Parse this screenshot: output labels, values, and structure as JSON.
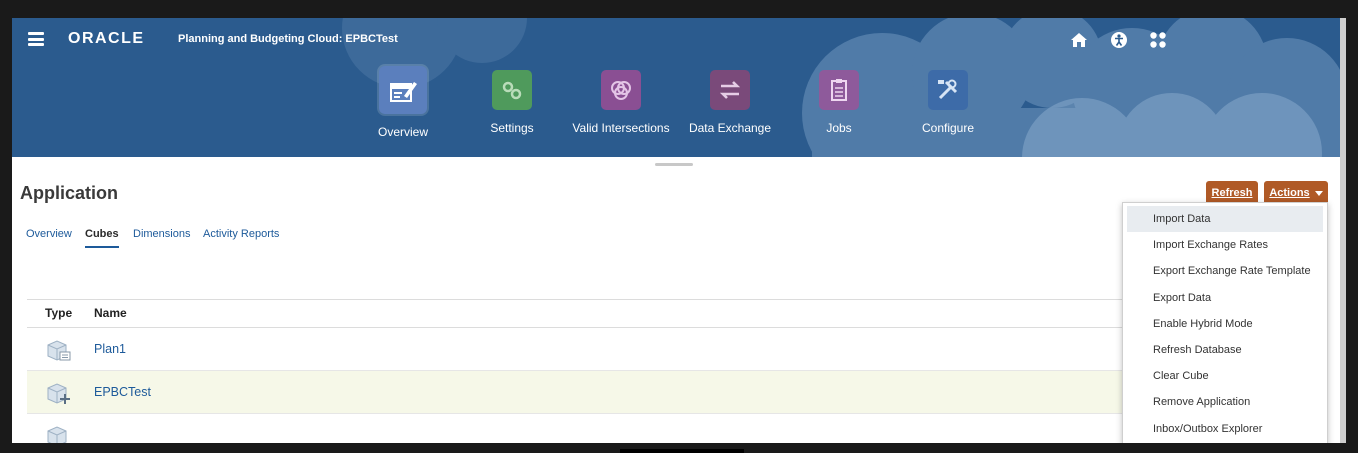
{
  "header": {
    "brand": "ORACLE",
    "app_title": "Planning and Budgeting Cloud: EPBCTest",
    "icons": [
      "menu-icon",
      "home-icon",
      "accessibility-icon",
      "apps-grid-icon"
    ]
  },
  "nav": {
    "items": [
      {
        "label": "Overview",
        "icon": "overview-icon",
        "color": "#5b7fbd"
      },
      {
        "label": "Settings",
        "icon": "settings-icon",
        "color": "#4f9a5c"
      },
      {
        "label": "Valid Intersections",
        "icon": "intersections-icon",
        "color": "#8a4f93"
      },
      {
        "label": "Data Exchange",
        "icon": "exchange-icon",
        "color": "#7a4a7a"
      },
      {
        "label": "Jobs",
        "icon": "jobs-icon",
        "color": "#8e5a9b"
      },
      {
        "label": "Configure",
        "icon": "configure-icon",
        "color": "#3d6ba8"
      }
    ],
    "active": "Overview"
  },
  "page": {
    "title": "Application",
    "refresh_label": "Refresh",
    "actions_label": "Actions"
  },
  "subtabs": [
    {
      "label": "Overview"
    },
    {
      "label": "Cubes"
    },
    {
      "label": "Dimensions"
    },
    {
      "label": "Activity Reports"
    }
  ],
  "active_subtab": "Cubes",
  "table": {
    "columns": [
      "Type",
      "Name"
    ],
    "rows": [
      {
        "name": "Plan1",
        "icon": "cube-icon"
      },
      {
        "name": "EPBCTest",
        "icon": "cube-add-icon"
      },
      {
        "name": "",
        "icon": "cube-icon"
      }
    ]
  },
  "actions_menu": {
    "items": [
      "Import Data",
      "Import Exchange Rates",
      "Export Exchange Rate Template",
      "Export Data",
      "Enable Hybrid Mode",
      "Refresh Database",
      "Clear Cube",
      "Remove Application",
      "Inbox/Outbox Explorer"
    ],
    "highlighted": "Import Data"
  },
  "colors": {
    "header_bg": "#2b5b8e",
    "accent_button": "#b05a26",
    "link": "#1d5a9a"
  }
}
